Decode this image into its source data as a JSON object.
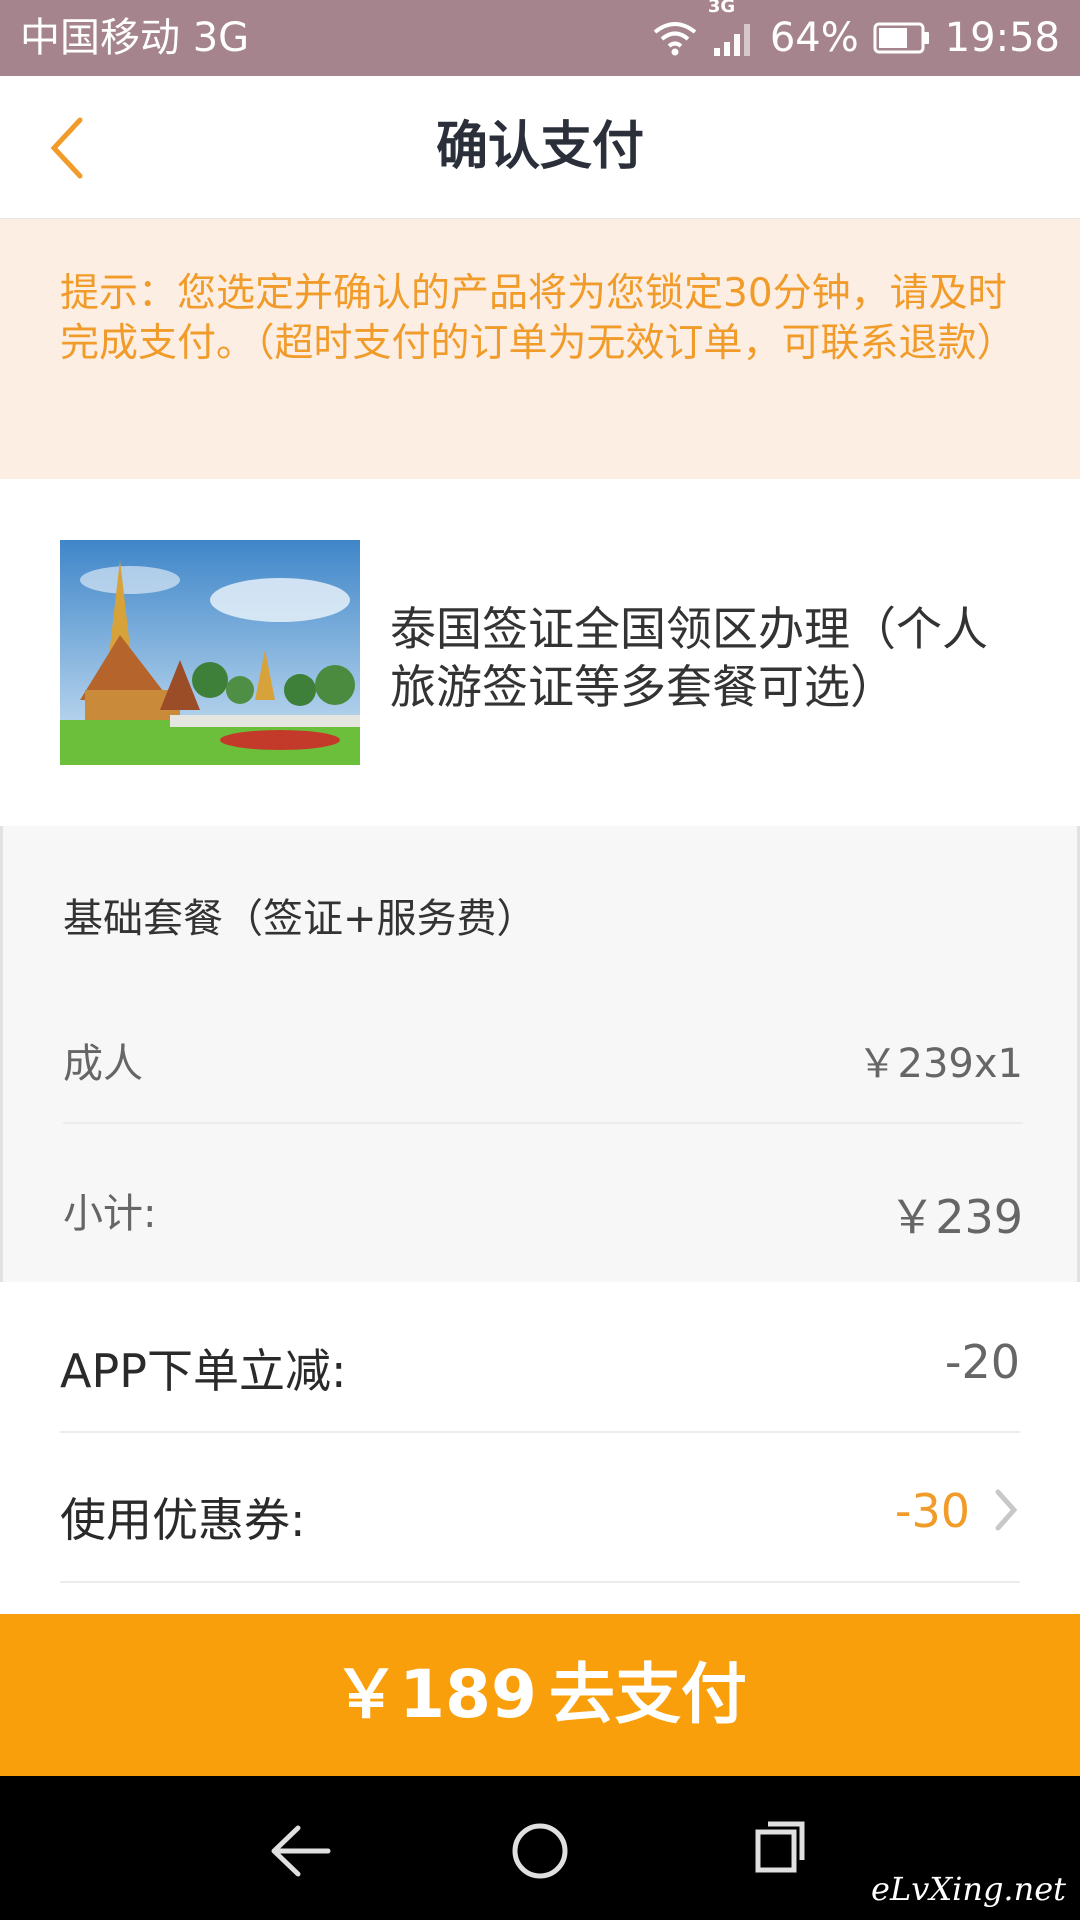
{
  "status_bar": {
    "carrier": "中国移动 3G",
    "network_label": "3G",
    "battery": "64%",
    "time": "19:58"
  },
  "header": {
    "title": "确认支付",
    "back_icon": "chevron-left-icon",
    "accent_color": "#f19c2a"
  },
  "notice": {
    "text": "提示：您选定并确认的产品将为您锁定30分钟，请及时完成支付。（超时支付的订单为无效订单，可联系退款）"
  },
  "product": {
    "name": "泰国签证全国领区办理（个人旅游签证等多套餐可选）",
    "image": "thai-temple-photo"
  },
  "package": {
    "title": "基础套餐（签证+服务费）",
    "adult_label": "成人",
    "adult_price": "￥239x1",
    "subtotal_label": "小计:",
    "subtotal_value": "￥239"
  },
  "discounts": {
    "app_label": "APP下单立减:",
    "app_value": "-20",
    "coupon_label": "使用优惠券:",
    "coupon_value": "-30"
  },
  "pay": {
    "amount": "￥189",
    "label": "去支付",
    "color": "#f99f0b"
  },
  "watermark": "eLvXing.net"
}
